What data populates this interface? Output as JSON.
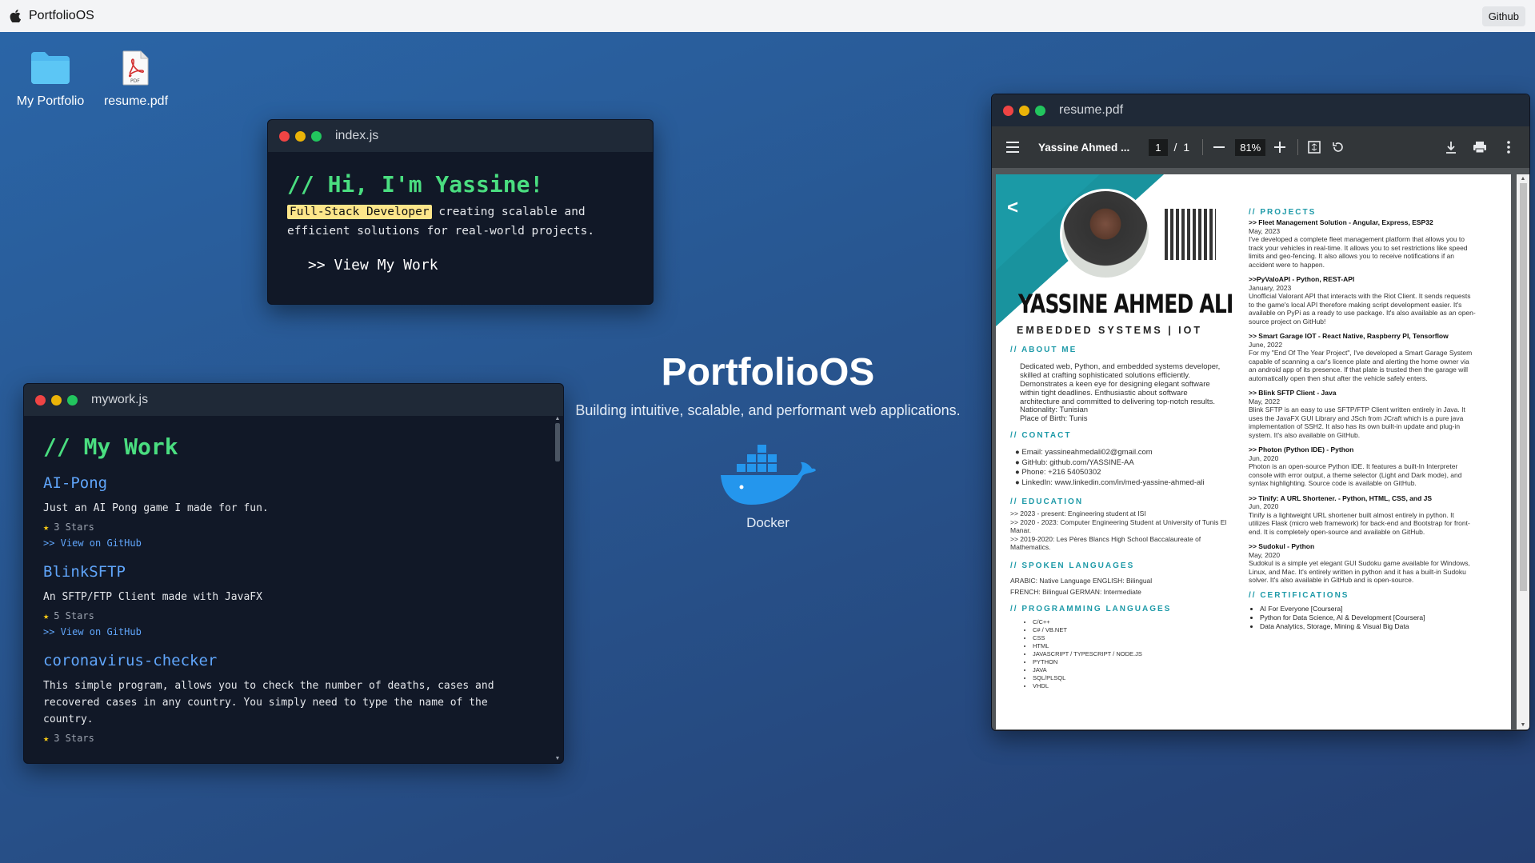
{
  "menubar": {
    "app_name": "PortfolioOS",
    "github_label": "Github"
  },
  "desktop": {
    "icons": [
      {
        "label": "My Portfolio",
        "icon": "folder-icon"
      },
      {
        "label": "resume.pdf",
        "icon": "pdf-file-icon"
      }
    ],
    "center": {
      "title": "PortfolioOS",
      "subtitle": "Building intuitive, scalable, and performant web applications.",
      "docker_label": "Docker"
    }
  },
  "index_window": {
    "title": "index.js",
    "heading": "// Hi, I'm Yassine!",
    "highlight": "Full-Stack Developer",
    "text_rest": " creating scalable and",
    "text_line2": "efficient solutions for real-world projects.",
    "cta": ">> View My Work"
  },
  "mywork_window": {
    "title": "mywork.js",
    "heading": "// My Work",
    "projects": [
      {
        "name": "AI-Pong",
        "description": "Just an AI Pong game I made for fun.",
        "stars": "3 Stars",
        "link": ">> View on GitHub"
      },
      {
        "name": "BlinkSFTP",
        "description": "An SFTP/FTP Client made with JavaFX",
        "stars": "5 Stars",
        "link": ">> View on GitHub"
      },
      {
        "name": "coronavirus-checker",
        "description": "This simple program, allows you to check the number of deaths, cases and recovered cases in any country. You simply need to type the name of the country.",
        "stars": "3 Stars",
        "link": ""
      }
    ]
  },
  "pdf_window": {
    "title": "resume.pdf",
    "toolbar": {
      "doc_title": "Yassine Ahmed ...",
      "page_current": "1",
      "page_sep": "/",
      "page_total": "1",
      "zoom": "81%"
    },
    "resume": {
      "back_arrow": "<",
      "name": "YASSINE AHMED ALI",
      "role": "EMBEDDED SYSTEMS | IOT",
      "about_heading": "// ABOUT ME",
      "about_text": "Dedicated web, Python, and embedded systems developer, skilled at crafting sophisticated solutions efficiently. Demonstrates a keen eye for designing elegant software within tight deadlines. Enthusiastic about software architecture and committed to delivering top-notch results.",
      "nationality": "Nationality: Tunisian",
      "birthplace": "Place of Birth: Tunis",
      "contact_heading": "// CONTACT",
      "contact": [
        "Email: yassineahmedali02@gmail.com",
        "GitHub: github.com/YASSINE-AA",
        "Phone: +216 54050302",
        "LinkedIn: www.linkedin.com/in/med-yassine-ahmed-ali"
      ],
      "education_heading": "// EDUCATION",
      "education": [
        ">> 2023 - present: Engineering student at ISI",
        ">> 2020 - 2023: Computer Engineering Student at University of Tunis El Manar.",
        ">> 2019-2020: Les Pères Blancs High School Baccalaureate of Mathematics."
      ],
      "languages_heading": "// SPOKEN LANGUAGES",
      "languages_line1": "ARABIC: Native Language ENGLISH: Bilingual",
      "languages_line2": "FRENCH: Bilingual  GERMAN: Intermediate",
      "prog_heading": "// PROGRAMMING LANGUAGES",
      "prog": [
        "C/C++",
        "C# / VB.NET",
        "CSS",
        "HTML",
        "JAVASCRIPT / TYPESCRIPT / NODE.JS",
        "PYTHON",
        "JAVA",
        "SQL/PLSQL",
        "VHDL"
      ],
      "projects_heading": "// PROJECTS",
      "projects": [
        {
          "title": ">> Fleet Management Solution - Angular, Express, ESP32",
          "date": "May, 2023",
          "text": "I've developed a complete fleet management platform that allows you to track your vehicles in real-time. It allows you to set restrictions like speed limits and geo-fencing. It also allows you to receive notifications if an accident were to happen."
        },
        {
          "title": ">>PyValoAPI - Python, REST-API",
          "date": "January, 2023",
          "text": "Unofficial Valorant API that interacts with the Riot Client. It sends requests to the game's local API therefore making script development easier. It's available on PyPi as a ready to use package. It's also available as an open-source project on GitHub!"
        },
        {
          "title": ">> Smart Garage IOT - React Native, Raspberry PI, Tensorflow",
          "date": "June, 2022",
          "text": "For my \"End Of The Year Project\", I've developed a Smart Garage System capable of scanning a car's licence plate and alerting the home owner via an android app of its presence. If that plate is trusted then the garage will automatically open then shut after the vehicle safely enters."
        },
        {
          "title": ">> Blink SFTP Client - Java",
          "date": "May, 2022",
          "text": "Blink SFTP is an easy to use SFTP/FTP Client written entirely in Java. It uses the JavaFX GUI Library and JSch from JCraft which is a pure java implementation of SSH2. It also has its own built-in update and plug-in system. It's also available on GitHub."
        },
        {
          "title": ">> Photon (Python IDE) - Python",
          "date": "Jun, 2020",
          "text": "Photon is an open-source Python IDE. It features a built-In Interpreter console with error output, a theme selector (Light and Dark mode), and syntax highlighting. Source code is available on GitHub."
        },
        {
          "title": ">> Tinify: A URL Shortener. - Python, HTML, CSS, and JS",
          "date": "Jun, 2020",
          "text": "Tinify is a lightweight URL shortener built almost entirely in python. It utilizes Flask (micro web framework) for back-end and Bootstrap for front-end. It is completely open-source and available on GitHub."
        },
        {
          "title": ">> Sudokul - Python",
          "date": "May, 2020",
          "text": "Sudokul is a simple yet elegant GUI Sudoku game available for Windows, Linux, and Mac. It's entirely written in python and it has a built-in Sudoku solver. It's also available in GitHub and is open-source."
        }
      ],
      "cert_heading": "// CERTIFICATIONS",
      "certs": [
        "AI For Everyone [Coursera]",
        "Python for Data Science, AI & Development [Coursera]",
        "Data Analytics, Storage, Mining & Visual Big Data"
      ]
    }
  },
  "colors": {
    "accent_green": "#4ade80",
    "accent_blue": "#60a5fa",
    "teal": "#1e9aa8"
  }
}
